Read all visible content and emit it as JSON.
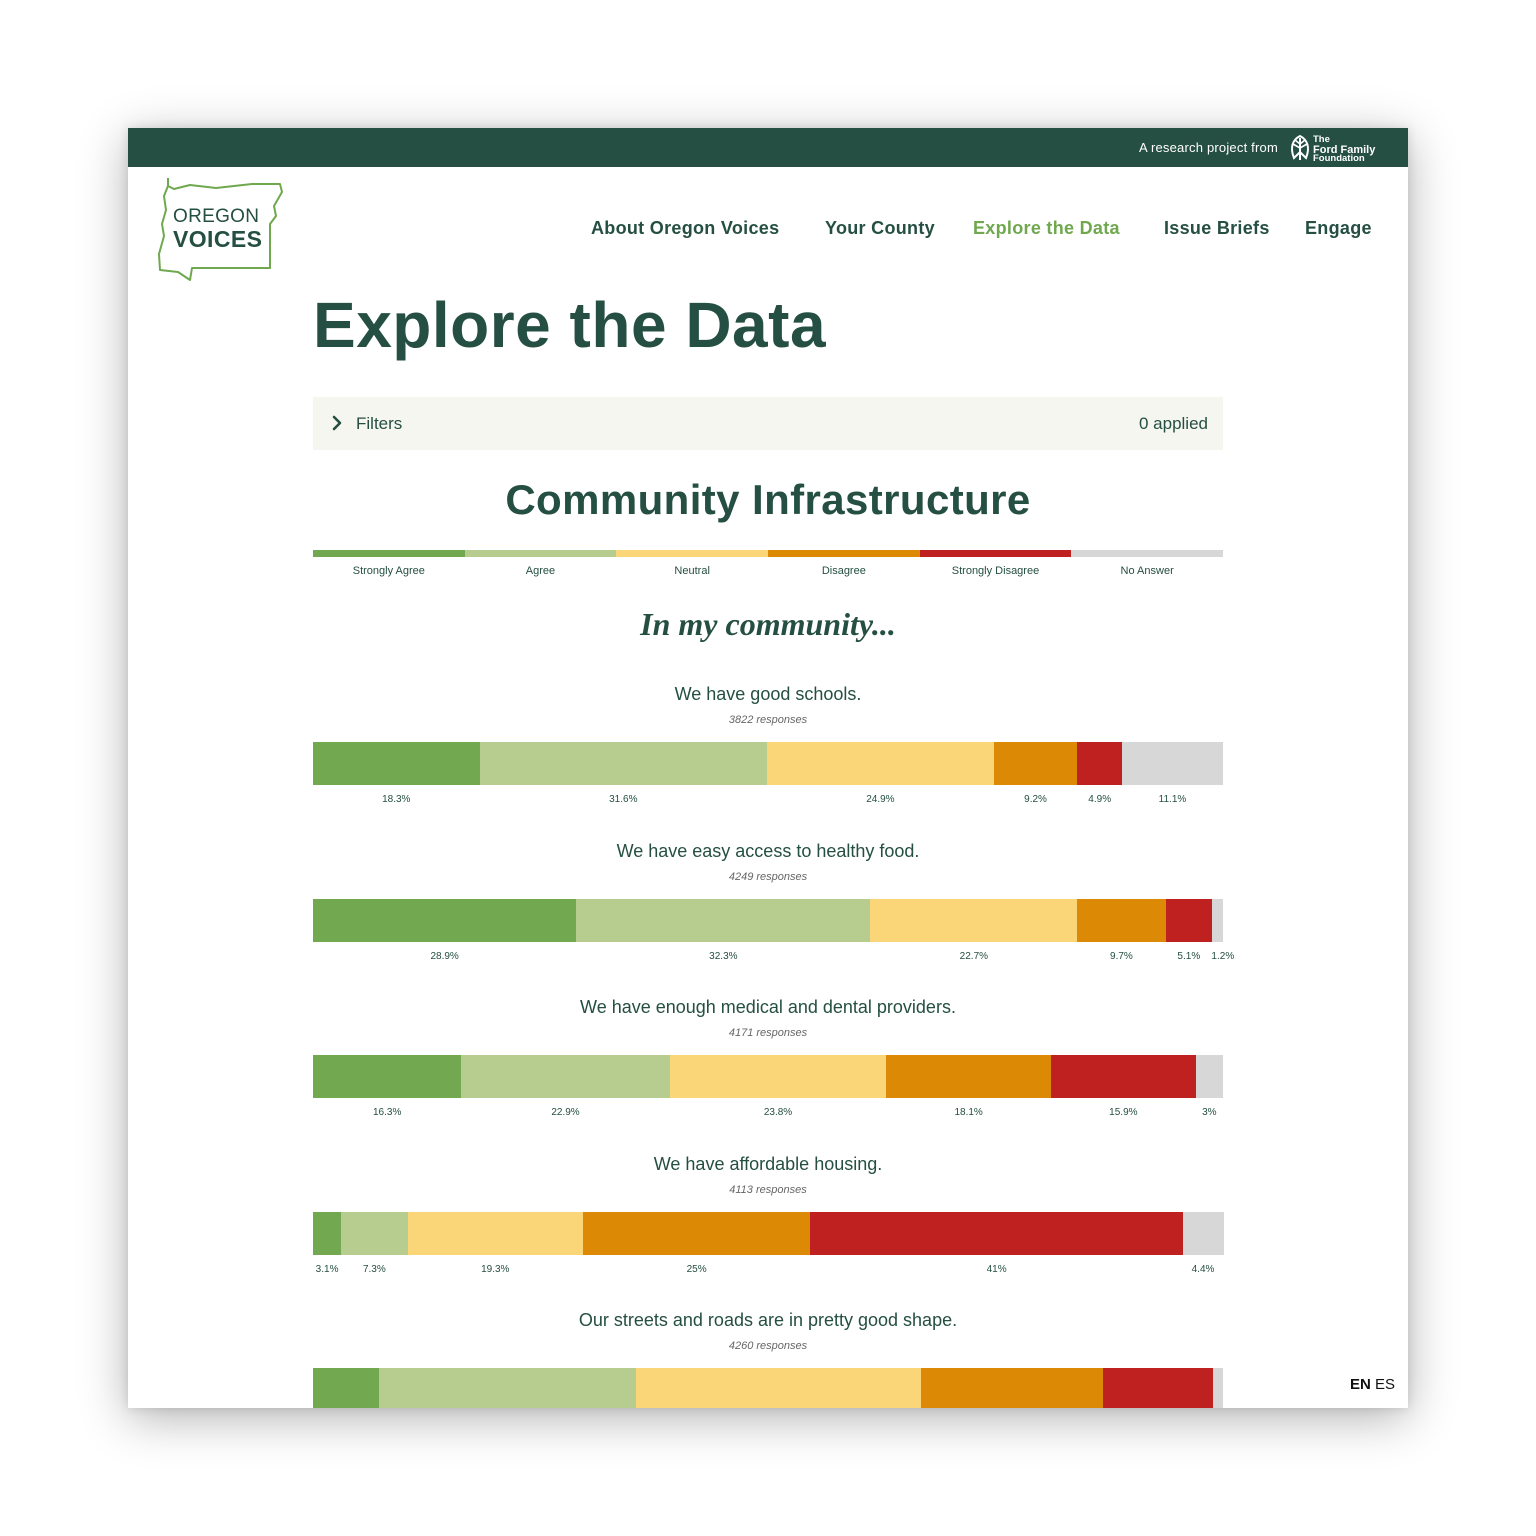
{
  "header": {
    "tagline": "A research project from",
    "foundation": {
      "line1": "The",
      "line2": "Ford Family",
      "line3": "Foundation"
    }
  },
  "logo": {
    "line1": "OREGON",
    "line2": "VOICES"
  },
  "nav": {
    "items": [
      {
        "label": "About Oregon Voices",
        "active": false
      },
      {
        "label": "Your County",
        "active": false
      },
      {
        "label": "Explore the Data",
        "active": true
      },
      {
        "label": "Issue Briefs",
        "active": false
      },
      {
        "label": "Engage",
        "active": false
      }
    ]
  },
  "page": {
    "title": "Explore the Data"
  },
  "filters": {
    "label": "Filters",
    "applied": "0 applied"
  },
  "section": {
    "title": "Community Infrastructure",
    "subtitle": "In my community..."
  },
  "colors": {
    "brand_dark": "#254f42",
    "brand_green": "#6fa84e",
    "strongly_agree": "#72a84f",
    "agree": "#b7cd8f",
    "neutral": "#fbd678",
    "disagree": "#dc8905",
    "strongly_disagree": "#bf2121",
    "no_answer": "#d7d7d7"
  },
  "legend": [
    {
      "label": "Strongly Agree",
      "color": "#72a84f"
    },
    {
      "label": "Agree",
      "color": "#b7cd8f"
    },
    {
      "label": "Neutral",
      "color": "#fbd678"
    },
    {
      "label": "Disagree",
      "color": "#dc8905"
    },
    {
      "label": "Strongly Disagree",
      "color": "#bf2121"
    },
    {
      "label": "No Answer",
      "color": "#d7d7d7"
    }
  ],
  "chart_data": {
    "type": "bar",
    "stacked": true,
    "orientation": "horizontal",
    "series_names": [
      "Strongly Agree",
      "Agree",
      "Neutral",
      "Disagree",
      "Strongly Disagree",
      "No Answer"
    ],
    "questions": [
      {
        "text": "We have good schools.",
        "responses": "3822 responses",
        "values": [
          18.3,
          31.6,
          24.9,
          9.2,
          4.9,
          11.1
        ],
        "labels": [
          "18.3%",
          "31.6%",
          "24.9%",
          "9.2%",
          "4.9%",
          "11.1%"
        ]
      },
      {
        "text": "We have easy access to healthy food.",
        "responses": "4249 responses",
        "values": [
          28.9,
          32.3,
          22.7,
          9.7,
          5.1,
          1.2
        ],
        "labels": [
          "28.9%",
          "32.3%",
          "22.7%",
          "9.7%",
          "5.1%",
          "1.2%"
        ]
      },
      {
        "text": "We have enough medical and dental providers.",
        "responses": "4171 responses",
        "values": [
          16.3,
          22.9,
          23.8,
          18.1,
          15.9,
          3
        ],
        "labels": [
          "16.3%",
          "22.9%",
          "23.8%",
          "18.1%",
          "15.9%",
          "3%"
        ]
      },
      {
        "text": "We have affordable housing.",
        "responses": "4113 responses",
        "values": [
          3.1,
          7.3,
          19.3,
          25,
          41,
          4.4
        ],
        "labels": [
          "3.1%",
          "7.3%",
          "19.3%",
          "25%",
          "41%",
          "4.4%"
        ]
      },
      {
        "text": "Our streets and roads are in pretty good shape.",
        "responses": "4260 responses",
        "values": [
          7.3,
          28.2,
          31.3,
          20,
          12.1,
          1.1
        ],
        "labels": []
      }
    ]
  },
  "lang": {
    "en": "EN",
    "es": "ES"
  }
}
